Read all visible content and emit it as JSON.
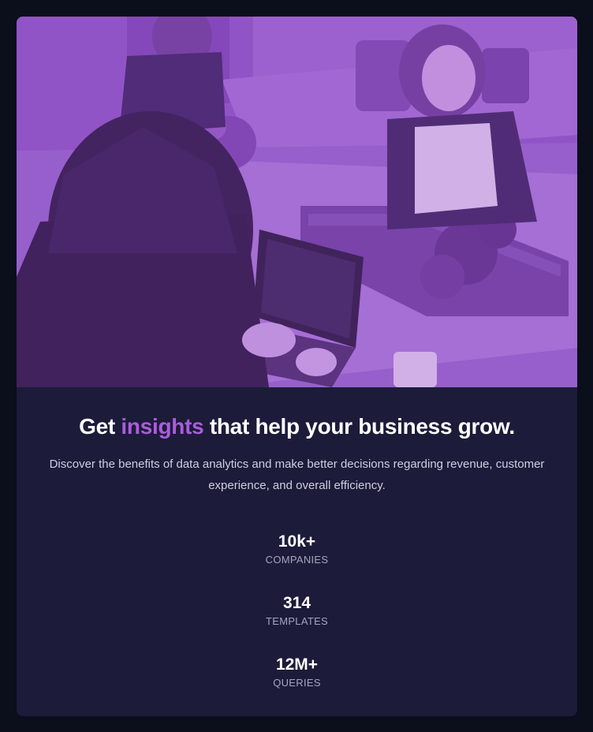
{
  "hero": {
    "image_alt": "Three women working on laptops at a shared office table",
    "overlay_color": "#aa5cdb"
  },
  "headline": {
    "before": "Get ",
    "accent": "insights",
    "after": " that help your business grow."
  },
  "description": "Discover the benefits of data analytics and make better decisions regarding revenue, customer experience, and overall efficiency.",
  "stats": [
    {
      "value": "10k+",
      "label": "COMPANIES"
    },
    {
      "value": "314",
      "label": "TEMPLATES"
    },
    {
      "value": "12M+",
      "label": "QUERIES"
    }
  ],
  "colors": {
    "page_background": "#0b0e1b",
    "card_background": "#1c1b39",
    "accent": "#ab5cdb",
    "text_primary": "#ffffff",
    "text_secondary": "#a7a5bd"
  }
}
